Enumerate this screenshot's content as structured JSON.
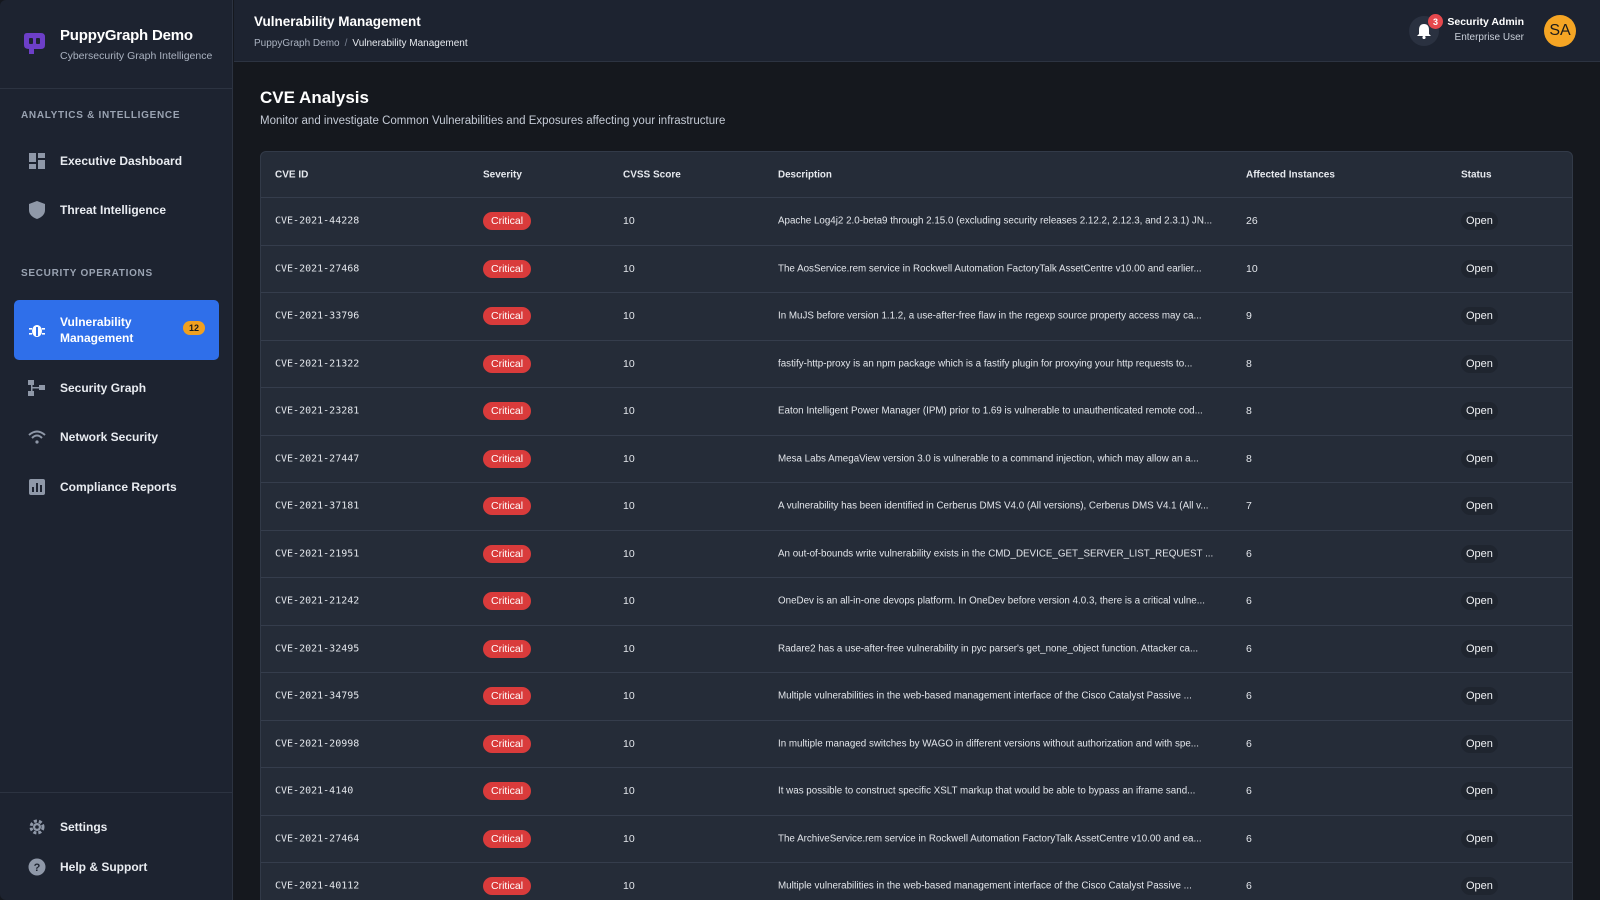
{
  "brand": {
    "title": "PuppyGraph Demo",
    "subtitle": "Cybersecurity Graph Intelligence"
  },
  "sidebar": {
    "sections": [
      {
        "label": "ANALYTICS & INTELLIGENCE"
      },
      {
        "label": "SECURITY OPERATIONS"
      }
    ],
    "items": [
      {
        "label": "Executive Dashboard",
        "icon": "dashboard-icon"
      },
      {
        "label": "Threat Intelligence",
        "icon": "shield-icon"
      },
      {
        "label": "Vulnerability Management",
        "icon": "bug-icon",
        "badge": "12",
        "active": true
      },
      {
        "label": "Security Graph",
        "icon": "graph-icon"
      },
      {
        "label": "Network Security",
        "icon": "wifi-icon"
      },
      {
        "label": "Compliance Reports",
        "icon": "bar-chart-icon"
      }
    ],
    "footer": [
      {
        "label": "Settings",
        "icon": "gear-icon"
      },
      {
        "label": "Help & Support",
        "icon": "help-icon"
      }
    ]
  },
  "header": {
    "title": "Vulnerability Management",
    "breadcrumb": [
      "PuppyGraph Demo",
      "/",
      "Vulnerability Management"
    ],
    "notifications": "3",
    "user_name": "Security Admin",
    "user_role": "Enterprise User",
    "avatar_initials": "SA"
  },
  "main": {
    "title": "CVE Analysis",
    "subtitle": "Monitor and investigate Common Vulnerabilities and Exposures affecting your infrastructure",
    "columns": [
      "CVE ID",
      "Severity",
      "CVSS Score",
      "Description",
      "Affected Instances",
      "Status"
    ],
    "rows": [
      {
        "id": "CVE-2021-44228",
        "severity": "Critical",
        "cvss": "10",
        "desc": "Apache Log4j2 2.0-beta9 through 2.15.0 (excluding security releases 2.12.2, 2.12.3, and 2.3.1) JN...",
        "affected": "26",
        "status": "Open"
      },
      {
        "id": "CVE-2021-27468",
        "severity": "Critical",
        "cvss": "10",
        "desc": "The AosService.rem service in Rockwell Automation FactoryTalk AssetCentre v10.00 and earlier...",
        "affected": "10",
        "status": "Open"
      },
      {
        "id": "CVE-2021-33796",
        "severity": "Critical",
        "cvss": "10",
        "desc": "In MuJS before version 1.1.2, a use-after-free flaw in the regexp source property access may ca...",
        "affected": "9",
        "status": "Open"
      },
      {
        "id": "CVE-2021-21322",
        "severity": "Critical",
        "cvss": "10",
        "desc": "fastify-http-proxy is an npm package which is a fastify plugin for proxying your http requests to...",
        "affected": "8",
        "status": "Open"
      },
      {
        "id": "CVE-2021-23281",
        "severity": "Critical",
        "cvss": "10",
        "desc": "Eaton Intelligent Power Manager (IPM) prior to 1.69 is vulnerable to unauthenticated remote cod...",
        "affected": "8",
        "status": "Open"
      },
      {
        "id": "CVE-2021-27447",
        "severity": "Critical",
        "cvss": "10",
        "desc": "Mesa Labs AmegaView version 3.0 is vulnerable to a command injection, which may allow an a...",
        "affected": "8",
        "status": "Open"
      },
      {
        "id": "CVE-2021-37181",
        "severity": "Critical",
        "cvss": "10",
        "desc": "A vulnerability has been identified in Cerberus DMS V4.0 (All versions), Cerberus DMS V4.1 (All v...",
        "affected": "7",
        "status": "Open"
      },
      {
        "id": "CVE-2021-21951",
        "severity": "Critical",
        "cvss": "10",
        "desc": "An out-of-bounds write vulnerability exists in the CMD_DEVICE_GET_SERVER_LIST_REQUEST ...",
        "affected": "6",
        "status": "Open"
      },
      {
        "id": "CVE-2021-21242",
        "severity": "Critical",
        "cvss": "10",
        "desc": "OneDev is an all-in-one devops platform. In OneDev before version 4.0.3, there is a critical vulne...",
        "affected": "6",
        "status": "Open"
      },
      {
        "id": "CVE-2021-32495",
        "severity": "Critical",
        "cvss": "10",
        "desc": "Radare2 has a use-after-free vulnerability in pyc parser's get_none_object function. Attacker ca...",
        "affected": "6",
        "status": "Open"
      },
      {
        "id": "CVE-2021-34795",
        "severity": "Critical",
        "cvss": "10",
        "desc": "Multiple vulnerabilities in the web-based management interface of the Cisco Catalyst Passive ...",
        "affected": "6",
        "status": "Open"
      },
      {
        "id": "CVE-2021-20998",
        "severity": "Critical",
        "cvss": "10",
        "desc": "In multiple managed switches by WAGO in different versions without authorization and with spe...",
        "affected": "6",
        "status": "Open"
      },
      {
        "id": "CVE-2021-4140",
        "severity": "Critical",
        "cvss": "10",
        "desc": "It was possible to construct specific XSLT markup that would be able to bypass an iframe sand...",
        "affected": "6",
        "status": "Open"
      },
      {
        "id": "CVE-2021-27464",
        "severity": "Critical",
        "cvss": "10",
        "desc": "The ArchiveService.rem service in Rockwell Automation FactoryTalk AssetCentre v10.00 and ea...",
        "affected": "6",
        "status": "Open"
      },
      {
        "id": "CVE-2021-40112",
        "severity": "Critical",
        "cvss": "10",
        "desc": "Multiple vulnerabilities in the web-based management interface of the Cisco Catalyst Passive ...",
        "affected": "6",
        "status": "Open"
      }
    ]
  },
  "colors": {
    "accent": "#2f6fea",
    "critical": "#d93b3b",
    "badge": "#f0a020",
    "avatar": "#f5a524",
    "notification": "#e5484d"
  }
}
